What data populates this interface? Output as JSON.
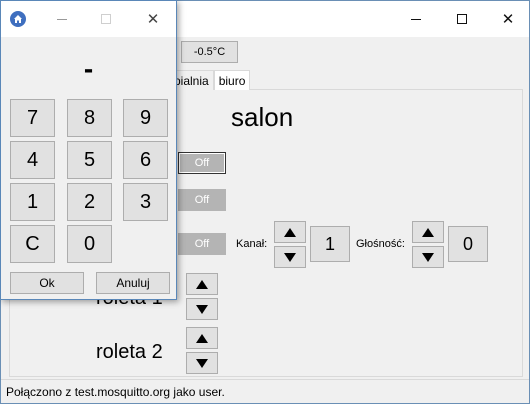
{
  "main_window": {
    "temperature": "-0.5°C",
    "tabs": [
      {
        "label": "pialnia",
        "active": false
      },
      {
        "label": "biuro",
        "active": true
      }
    ],
    "room_title": "salon",
    "toggles": [
      "Off",
      "Off",
      "Off"
    ],
    "tv": {
      "channel_label": "Kanał:",
      "channel_value": "1",
      "volume_label": "Głośność:",
      "volume_value": "0"
    },
    "blinds": [
      "roleta 1",
      "roleta 2"
    ],
    "status": "Połączono z test.mosquitto.org jako user."
  },
  "keypad": {
    "display": "-",
    "keys": [
      "7",
      "8",
      "9",
      "4",
      "5",
      "6",
      "1",
      "2",
      "3",
      "C",
      "0"
    ],
    "ok_label": "Ok",
    "cancel_label": "Anuluj"
  },
  "colors": {
    "window_bg": "#f0f0f0",
    "button_bg": "#e1e1e1",
    "toggle_off": "#b4b4b4",
    "app_icon": "#3f6fbf",
    "desktop": "#2b6fb3"
  },
  "icons": {
    "app_icon": "home-icon",
    "minimize": "minimize-icon",
    "maximize": "maximize-icon",
    "close": "close-icon",
    "up": "arrow-up-icon",
    "down": "arrow-down-icon"
  }
}
